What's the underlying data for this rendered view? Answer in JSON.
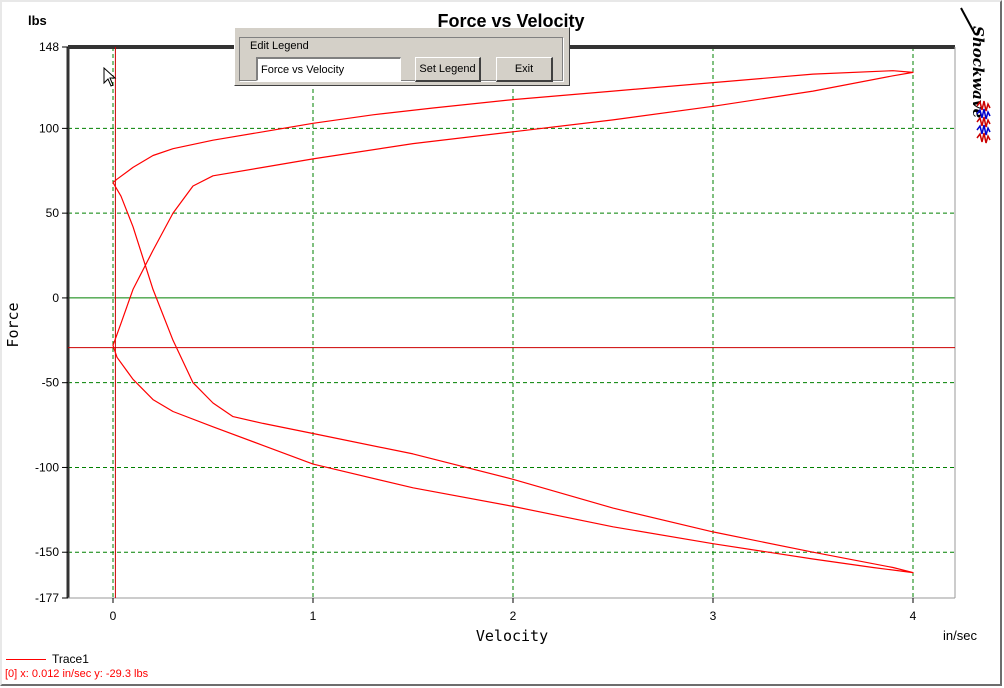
{
  "dialog": {
    "title": "Edit Legend",
    "legend_value": "Force vs Velocity",
    "set_legend_label": "Set Legend",
    "exit_label": "Exit"
  },
  "brand": {
    "name": "Shockwave"
  },
  "legend": {
    "label": "Trace1",
    "color": "#ff0000"
  },
  "status": {
    "text": "[0]  x: 0.012 in/sec  y: -29.3 lbs"
  },
  "colors": {
    "trace": "#ff0000",
    "grid": "#008000",
    "zero_line": "#008000",
    "cursor_line": "#cc0000",
    "dialog_bg": "#d4d0c8"
  },
  "chart_data": {
    "type": "line",
    "title": "Force vs Velocity",
    "xlabel": "Velocity",
    "ylabel": "Force",
    "x_unit": "in/sec",
    "y_unit": "lbs",
    "xlim": [
      -0.1,
      4.2
    ],
    "ylim": [
      -177,
      148
    ],
    "xticks": [
      0,
      1,
      2,
      3,
      4
    ],
    "yticks": [
      148,
      100,
      50,
      0,
      -50,
      -100,
      -150,
      -177
    ],
    "grid": true,
    "zero_line_y": 0,
    "cursor": {
      "x": 0.012,
      "y": -29.3
    },
    "legend_position": "bottom-left",
    "series": [
      {
        "name": "Trace1",
        "points": [
          [
            0.0,
            68
          ],
          [
            0.02,
            70
          ],
          [
            0.1,
            77
          ],
          [
            0.2,
            84
          ],
          [
            0.3,
            88
          ],
          [
            0.5,
            93
          ],
          [
            0.75,
            98
          ],
          [
            1.0,
            103
          ],
          [
            1.3,
            108
          ],
          [
            1.6,
            112
          ],
          [
            2.0,
            117
          ],
          [
            2.5,
            122
          ],
          [
            3.0,
            127
          ],
          [
            3.5,
            132
          ],
          [
            3.9,
            134
          ],
          [
            4.0,
            133
          ],
          [
            3.9,
            131
          ],
          [
            3.5,
            122
          ],
          [
            3.0,
            113
          ],
          [
            2.5,
            105
          ],
          [
            2.0,
            98
          ],
          [
            1.5,
            91
          ],
          [
            1.0,
            82
          ],
          [
            0.75,
            77
          ],
          [
            0.5,
            72
          ],
          [
            0.4,
            66
          ],
          [
            0.3,
            50
          ],
          [
            0.2,
            28
          ],
          [
            0.1,
            5
          ],
          [
            0.04,
            -15
          ],
          [
            0.0,
            -28
          ],
          [
            0.02,
            -35
          ],
          [
            0.1,
            -48
          ],
          [
            0.2,
            -60
          ],
          [
            0.3,
            -67
          ],
          [
            0.5,
            -76
          ],
          [
            0.75,
            -87
          ],
          [
            1.0,
            -98
          ],
          [
            1.5,
            -112
          ],
          [
            2.0,
            -123
          ],
          [
            2.5,
            -135
          ],
          [
            3.0,
            -145
          ],
          [
            3.5,
            -154
          ],
          [
            3.8,
            -159
          ],
          [
            4.0,
            -162
          ],
          [
            3.9,
            -159
          ],
          [
            3.5,
            -150
          ],
          [
            3.0,
            -138
          ],
          [
            2.5,
            -124
          ],
          [
            2.0,
            -107
          ],
          [
            1.5,
            -92
          ],
          [
            1.0,
            -80
          ],
          [
            0.75,
            -74
          ],
          [
            0.6,
            -70
          ],
          [
            0.5,
            -62
          ],
          [
            0.4,
            -50
          ],
          [
            0.3,
            -25
          ],
          [
            0.2,
            5
          ],
          [
            0.1,
            42
          ],
          [
            0.04,
            60
          ],
          [
            0.0,
            68
          ]
        ]
      }
    ]
  }
}
